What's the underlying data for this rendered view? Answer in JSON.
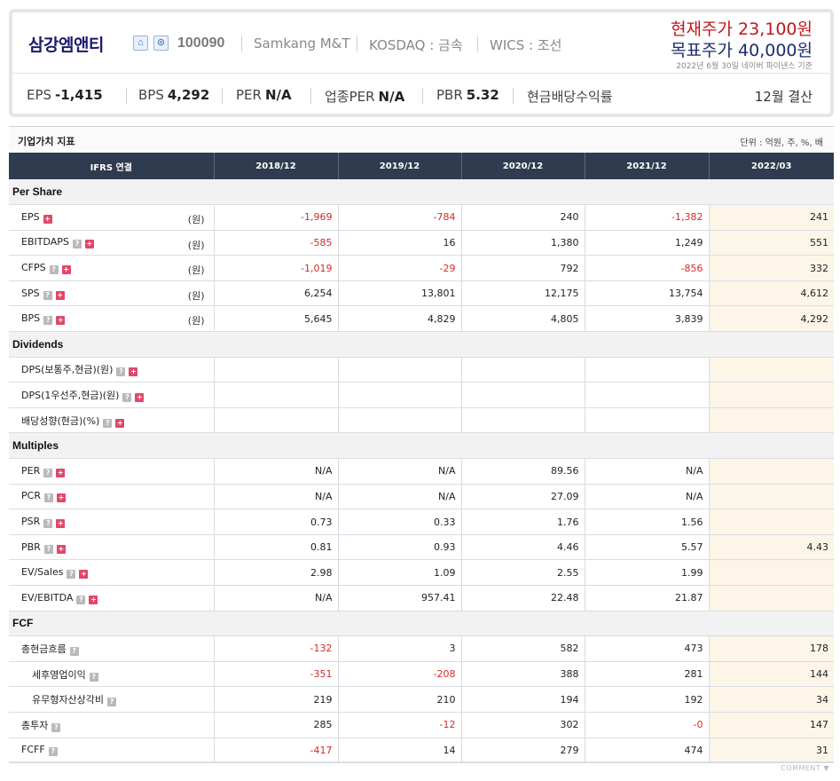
{
  "header": {
    "company_name": "삼강엠앤티",
    "icons": [
      "home-icon",
      "store-icon"
    ],
    "code": "100090",
    "english_name": "Samkang M&T",
    "market": "KOSDAQ : 금속",
    "wics": "WICS : 조선",
    "current_price": "현재주가 23,100원",
    "target_price": "목표주가 40,000원",
    "price_source": "2022년 6월 30일 네이버 파이낸스 기준",
    "metrics": [
      {
        "label": "EPS",
        "value": "-1,415"
      },
      {
        "label": "BPS",
        "value": "4,292"
      },
      {
        "label": "PER",
        "value": "N/A"
      },
      {
        "label": "업종PER",
        "value": "N/A"
      },
      {
        "label": "PBR",
        "value": "5.32"
      },
      {
        "label": "현금배당수익률",
        "value": ""
      }
    ],
    "settlement": "12월 결산"
  },
  "section": {
    "title": "기업가치 지표",
    "unit": "단위 : 억원, 주, %, 배"
  },
  "table": {
    "header": [
      "IFRS 연결",
      "2018/12",
      "2019/12",
      "2020/12",
      "2021/12",
      "2022/03"
    ],
    "groups": [
      {
        "name": "Per Share",
        "rows": [
          {
            "label": "EPS",
            "unit": "(원)",
            "help": false,
            "plus": true,
            "values": [
              "-1,969",
              "-784",
              "240",
              "-1,382",
              "241"
            ]
          },
          {
            "label": "EBITDAPS",
            "unit": "(원)",
            "help": true,
            "plus": true,
            "values": [
              "-585",
              "16",
              "1,380",
              "1,249",
              "551"
            ]
          },
          {
            "label": "CFPS",
            "unit": "(원)",
            "help": true,
            "plus": true,
            "values": [
              "-1,019",
              "-29",
              "792",
              "-856",
              "332"
            ]
          },
          {
            "label": "SPS",
            "unit": "(원)",
            "help": true,
            "plus": true,
            "values": [
              "6,254",
              "13,801",
              "12,175",
              "13,754",
              "4,612"
            ]
          },
          {
            "label": "BPS",
            "unit": "(원)",
            "help": true,
            "plus": true,
            "values": [
              "5,645",
              "4,829",
              "4,805",
              "3,839",
              "4,292"
            ]
          }
        ]
      },
      {
        "name": "Dividends",
        "rows": [
          {
            "label": "DPS(보통주,현금)(원)",
            "unit": "",
            "help": true,
            "plus": true,
            "values": [
              "",
              "",
              "",
              "",
              ""
            ]
          },
          {
            "label": "DPS(1우선주,현금)(원)",
            "unit": "",
            "help": true,
            "plus": true,
            "values": [
              "",
              "",
              "",
              "",
              ""
            ]
          },
          {
            "label": "배당성향(현금)(%)",
            "unit": "",
            "help": true,
            "plus": true,
            "values": [
              "",
              "",
              "",
              "",
              ""
            ]
          }
        ]
      },
      {
        "name": "Multiples",
        "rows": [
          {
            "label": "PER",
            "unit": "",
            "help": true,
            "plus": true,
            "values": [
              "N/A",
              "N/A",
              "89.56",
              "N/A",
              ""
            ]
          },
          {
            "label": "PCR",
            "unit": "",
            "help": true,
            "plus": true,
            "values": [
              "N/A",
              "N/A",
              "27.09",
              "N/A",
              ""
            ]
          },
          {
            "label": "PSR",
            "unit": "",
            "help": true,
            "plus": true,
            "values": [
              "0.73",
              "0.33",
              "1.76",
              "1.56",
              ""
            ]
          },
          {
            "label": "PBR",
            "unit": "",
            "help": true,
            "plus": true,
            "values": [
              "0.81",
              "0.93",
              "4.46",
              "5.57",
              "4.43"
            ]
          },
          {
            "label": "EV/Sales",
            "unit": "",
            "help": true,
            "plus": true,
            "values": [
              "2.98",
              "1.09",
              "2.55",
              "1.99",
              ""
            ]
          },
          {
            "label": "EV/EBITDA",
            "unit": "",
            "help": true,
            "plus": true,
            "values": [
              "N/A",
              "957.41",
              "22.48",
              "21.87",
              ""
            ]
          }
        ]
      },
      {
        "name": "FCF",
        "rows": [
          {
            "label": "총현금흐름",
            "unit": "",
            "help": true,
            "plus": false,
            "sub": false,
            "values": [
              "-132",
              "3",
              "582",
              "473",
              "178"
            ]
          },
          {
            "label": "세후영업이익",
            "unit": "",
            "help": true,
            "plus": false,
            "sub": true,
            "values": [
              "-351",
              "-208",
              "388",
              "281",
              "144"
            ]
          },
          {
            "label": "유무형자산상각비",
            "unit": "",
            "help": true,
            "plus": false,
            "sub": true,
            "values": [
              "219",
              "210",
              "194",
              "192",
              "34"
            ]
          },
          {
            "label": "총투자",
            "unit": "",
            "help": true,
            "plus": false,
            "sub": false,
            "values": [
              "285",
              "-12",
              "302",
              "-0",
              "147"
            ]
          },
          {
            "label": "FCFF",
            "unit": "",
            "help": true,
            "plus": false,
            "sub": false,
            "values": [
              "-417",
              "14",
              "279",
              "474",
              "31"
            ]
          }
        ]
      }
    ]
  },
  "footer": {
    "comment": "COMMENT ▼"
  },
  "colors": {
    "negative": "#d32b2b",
    "header_bg": "#2f3c4f",
    "latest_col_bg": "#fcf5e8",
    "current_price": "#c0161b",
    "target_price": "#1a2d6e"
  }
}
